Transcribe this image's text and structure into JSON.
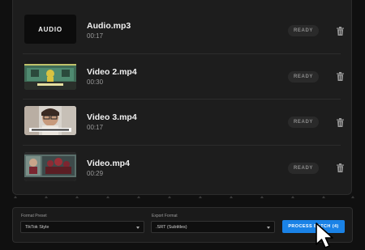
{
  "files": [
    {
      "name": "Audio.mp3",
      "duration": "00:17",
      "status": "READY",
      "thumbnail": "audio-placeholder",
      "thumbnail_label": "AUDIO"
    },
    {
      "name": "Video 2.mp4",
      "duration": "00:30",
      "status": "READY",
      "thumbnail": "video-frame"
    },
    {
      "name": "Video 3.mp4",
      "duration": "00:17",
      "status": "READY",
      "thumbnail": "video-frame"
    },
    {
      "name": "Video.mp4",
      "duration": "00:29",
      "status": "READY",
      "thumbnail": "video-frame"
    }
  ],
  "footer": {
    "format_preset_label": "Format Preset",
    "format_preset_value": "TikTok Style",
    "export_format_label": "Export Format",
    "export_format_value": ".SRT (Subtitles)",
    "process_button_label": "PROCESS BATCH (4)"
  },
  "icons": {
    "delete": "trash-icon",
    "select_chevron": "chevron-down-icon",
    "cursor": "mouse-pointer-icon"
  },
  "colors": {
    "accent": "#1a82e6",
    "panel": "#1d1d1d",
    "background": "#101010",
    "status_badge": "#2a2a2a"
  }
}
